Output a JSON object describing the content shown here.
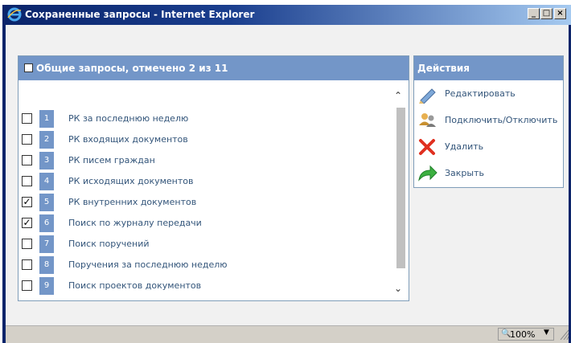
{
  "window": {
    "title": "Сохраненные запросы - Internet Explorer"
  },
  "queries": {
    "header": "Общие запросы, отмечено 2 из 11",
    "items": [
      {
        "num": "1",
        "label": "РК за последнюю неделю",
        "checked": false
      },
      {
        "num": "2",
        "label": "РК входящих документов",
        "checked": false
      },
      {
        "num": "3",
        "label": "РК писем граждан",
        "checked": false
      },
      {
        "num": "4",
        "label": "РК исходящих документов",
        "checked": false
      },
      {
        "num": "5",
        "label": "РК внутренних документов",
        "checked": true
      },
      {
        "num": "6",
        "label": "Поиск по журналу передачи",
        "checked": true
      },
      {
        "num": "7",
        "label": "Поиск поручений",
        "checked": false
      },
      {
        "num": "8",
        "label": "Поручения за последнюю неделю",
        "checked": false
      },
      {
        "num": "9",
        "label": "Поиск проектов документов",
        "checked": false
      }
    ]
  },
  "actions": {
    "header": "Действия",
    "items": [
      {
        "label": "Редактировать",
        "icon": "pencil-icon"
      },
      {
        "label": "Подключить/Отключить",
        "icon": "users-icon"
      },
      {
        "label": "Удалить",
        "icon": "delete-x-icon"
      },
      {
        "label": "Закрыть",
        "icon": "green-arrow-icon"
      }
    ]
  },
  "status": {
    "zoom": "100%"
  },
  "colors": {
    "header_bg": "#7396c8",
    "title_bar": "#0a246a",
    "link_text": "#33557a"
  }
}
